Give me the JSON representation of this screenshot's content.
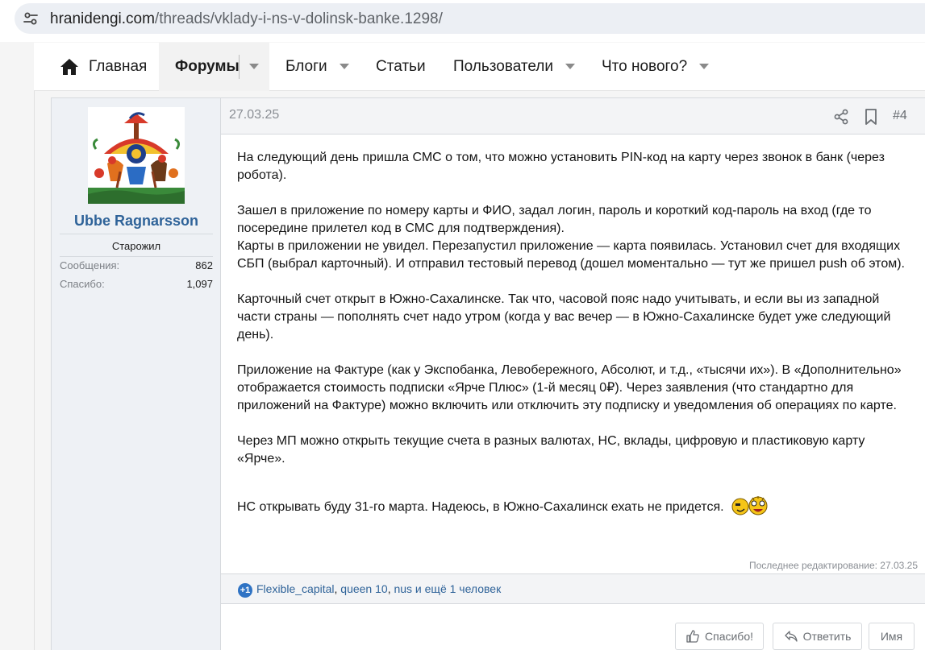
{
  "browser": {
    "url_host": "hranidengi.com",
    "url_path": "/threads/vklady-i-ns-v-dolinsk-banke.1298/"
  },
  "nav": {
    "home": "Главная",
    "forums": "Форумы",
    "blogs": "Блоги",
    "articles": "Статьи",
    "users": "Пользователи",
    "whats_new": "Что нового?"
  },
  "user": {
    "name": "Ubbe Ragnarsson",
    "title": "Старожил",
    "stats": [
      {
        "label": "Сообщения:",
        "value": "862"
      },
      {
        "label": "Спасибо:",
        "value": "1,097"
      }
    ]
  },
  "post": {
    "date": "27.03.25",
    "number": "#4",
    "paragraphs": [
      "На следующий день пришла СМС о том, что можно установить PIN-код на карту через звонок в банк (через робота).",
      "Зашел в приложение по номеру карты и ФИО, задал логин, пароль и короткий код-пароль на вход (где то посередине прилетел код в СМС для подтверждения).",
      "Карты в приложении не увидел. Перезапустил приложение — карта появилась. Установил счет для входящих СБП (выбрал карточный). И отправил тестовый перевод (дошел моментально — тут же пришел push об этом).",
      "Карточный счет открыт в Южно-Сахалинске. Так что, часовой пояс надо учитывать, и если вы из западной части страны — пополнять счет надо утром (когда у вас вечер — в Южно-Сахалинске будет уже следующий день).",
      "Приложение на Фактуре (как у Экспобанка, Левобережного, Абсолют, и т.д., «тысячи их»). В «Дополнительно» отображается стоимость подписки «Ярче Плюс» (1-й месяц 0₽). Через заявления (что стандартно для приложений на Фактуре) можно включить или отключить эту подписку и уведомления об операциях по карте.",
      "Через МП можно открыть текущие счета в разных валютах, НС, вклады, цифровую и пластиковую карту «Ярче».",
      "НС открывать буду 31-го марта. Надеюсь, в Южно-Сахалинск ехать не придется."
    ],
    "last_edited": "Последнее редактирование: 27.03.25"
  },
  "reactions": {
    "badge": "+1",
    "users": [
      "Flexible_capital",
      "queen 10",
      "nus"
    ],
    "sep1": ", ",
    "sep2": ", ",
    "tail": " и ещё 1 человек"
  },
  "actions": {
    "thanks": "Спасибо!",
    "reply": "Ответить",
    "name": "Имя"
  },
  "colors": {
    "accent": "#2f6399",
    "badge": "#2f73c4",
    "user_column_bg": "#eef1f5"
  }
}
